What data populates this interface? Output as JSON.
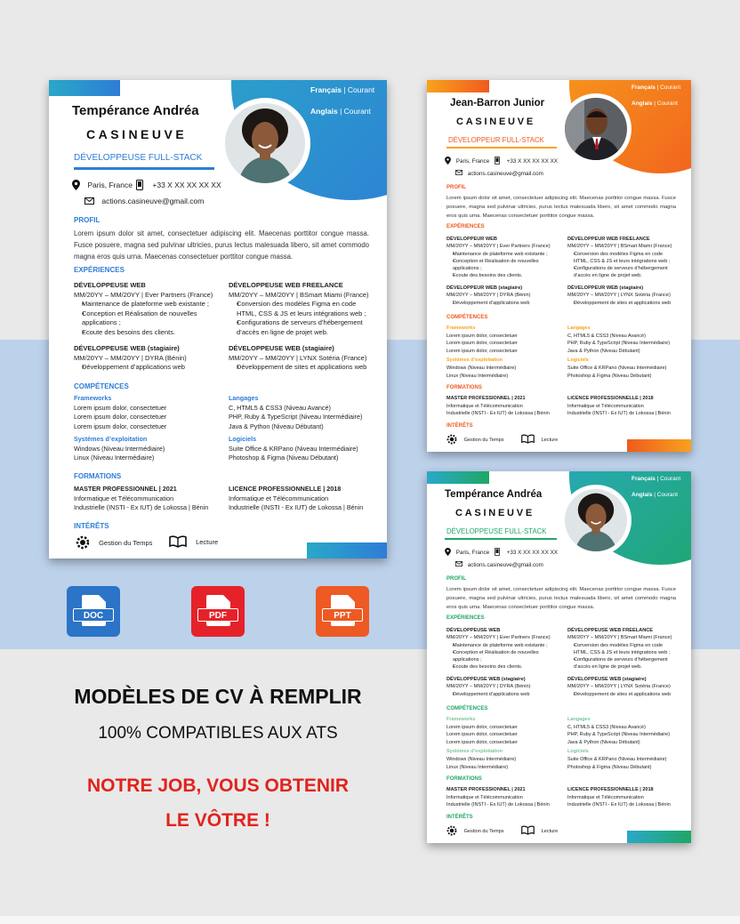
{
  "colors": {
    "blue": "#2e7dd6",
    "teal": "#2aa8c8",
    "orange": "#f05a1e",
    "orange_light": "#f8a21c",
    "green": "#1ea765",
    "red": "#e1231c",
    "doc_blue": "#2b74c7",
    "pdf_red": "#e52229",
    "ppt_orange": "#ee5a23"
  },
  "resume": {
    "lang1": "Français",
    "lang2": "Anglais",
    "level": "Courant",
    "first_name": "Tempérance Andréa",
    "surname": "CASINEUVE",
    "role_f": "DÉVELOPPEUSE FULL-STACK",
    "city": "Paris, France",
    "phone": "+33 X XX XX XX XX",
    "email": "actions.casineuve@gmail.com",
    "profile_title": "PROFIL",
    "profile_text": "Lorem ipsum dolor sit amet, consectetuer adipiscing elit. Maecenas porttitor congue massa. Fusce posuere, magna sed pulvinar ultricies, purus lectus malesuada libero, sit amet commodo magna eros quis urna. Maecenas consectetuer porttitor congue massa.",
    "exp_title": "EXPÉRIENCES",
    "exp1": {
      "title_f": "DÉVELOPPEUSE WEB",
      "meta": "MM/20YY – MM/20YY | Ever Partners (France)",
      "b1": "Maintenance de plateforme web existante ;",
      "b2": "Conception et Réalisation de nouvelles applications ;",
      "b3": "Ecoute des besoins des clients."
    },
    "exp2": {
      "title_f": "DÉVELOPPEUSE WEB FREELANCE",
      "meta": "MM/20YY – MM/20YY | BSmart Miami (France)",
      "b1": "Conversion des modèles Figma en code HTML, CSS & JS et leurs intégrations web ;",
      "b2": "Configurations de serveurs d’hébergement d’accès en ligne de projet web."
    },
    "exp3": {
      "title_f": "DÉVELOPPEUSE WEB (stagiaire)",
      "meta": "MM/20YY – MM/20YY | DYRA (Bénin)",
      "b1": "Développement d’applications web"
    },
    "exp4": {
      "title_f": "DÉVELOPPEUSE WEB (stagiaire)",
      "meta": "MM/20YY – MM/20YY | LYNX Sotéria (France)",
      "b1": "Développement de sites et applications web"
    },
    "skills_title": "COMPÉTENCES",
    "frameworks_title": "Frameworks",
    "fw1": "Lorem ipsum dolor, consectetuer",
    "fw2": "Lorem ipsum dolor, consectetuer",
    "fw3": "Lorem ipsum dolor, consectetuer",
    "languages_title": "Langages",
    "lg1": "C, HTML5 & CSS3 (Niveau Avancé)",
    "lg2": "PHP, Ruby & TypeScript (Niveau Intermédiaire)",
    "lg3": "Java & Python (Niveau Débutant)",
    "os_title": "Systèmes d’exploitation",
    "os1": "Windows (Niveau Intermédiaire)",
    "os2": "Linux (Niveau Intermédiaire)",
    "software_title": "Logiciels",
    "sw1": "Suite Office & KRPano (Niveau Intermédiaire)",
    "sw2": "Photoshop & Figma (Niveau Débutant)",
    "edu_title": "FORMATIONS",
    "edu1": {
      "title": "MASTER PROFESSIONNEL | 2021",
      "l1": "Informatique et Télécommunication",
      "l2": "Industrielle (INSTI - Ex IUT) de Lokossa | Bénin"
    },
    "edu2": {
      "title": "LICENCE PROFESSIONNELLE | 2018",
      "l1": "Informatique et Télécommunication",
      "l2": "Industrielle (INSTI - Ex IUT) de Lokossa | Bénin"
    },
    "interests_title": "INTÉRÊTS",
    "interest1": "Gestion du Temps",
    "interest2": "Lecture"
  },
  "resume_male": {
    "first_name": "Jean-Barron Junior",
    "surname": "CASINEUVE",
    "role": "DÉVELOPPEUR FULL-STACK",
    "exp1_title": "DÉVELOPPEUR WEB",
    "exp2_title": "DÉVELOPPEUR WEB FREELANCE",
    "exp3_title": "DÉVELOPPEUR WEB (stagiaire)",
    "exp4_title": "DÉVELOPPEUR WEB (stagiaire)"
  },
  "formats": {
    "doc": "DOC",
    "pdf": "PDF",
    "ppt": "PPT"
  },
  "promo": {
    "line1": "MODÈLES DE CV À REMPLIR",
    "line2": "100% COMPATIBLES AUX ATS",
    "line3": "NOTRE JOB, VOUS OBTENIR",
    "line4": "LE VÔTRE !"
  }
}
